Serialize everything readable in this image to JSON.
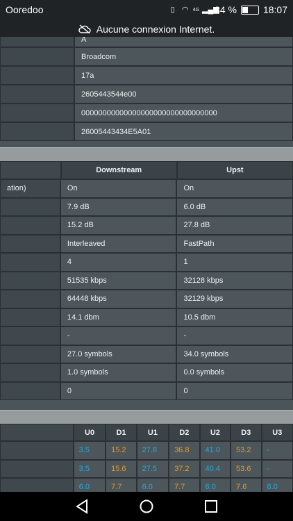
{
  "status_bar": {
    "carrier": "Ooredoo",
    "network_label": "4G",
    "battery_percent": "34 %",
    "time": "18:07"
  },
  "banner": {
    "text": "Aucune connexion Internet."
  },
  "info_table": {
    "values": [
      "A",
      "Broadcom",
      "17a",
      "2605443544e00",
      "00000000000000000000000000000000",
      "26005443434E5A01"
    ]
  },
  "line_stats": {
    "headers": [
      "Downstream",
      "Upst"
    ],
    "rows": [
      {
        "label": "ation)",
        "down": "On",
        "up": "On"
      },
      {
        "label": "",
        "down": "7.9 dB",
        "up": "6.0 dB"
      },
      {
        "label": "",
        "down": "15.2 dB",
        "up": "27.8 dB"
      },
      {
        "label": "",
        "down": "Interleaved",
        "up": "FastPath"
      },
      {
        "label": "",
        "down": "4",
        "up": "1"
      },
      {
        "label": "",
        "down": "51535 kbps",
        "up": "32128 kbps"
      },
      {
        "label": "",
        "down": "64448 kbps",
        "up": "32129 kbps"
      },
      {
        "label": "",
        "down": "14.1 dbm",
        "up": "10.5 dbm"
      },
      {
        "label": "",
        "down": "-",
        "up": "-"
      },
      {
        "label": "",
        "down": "27.0 symbols",
        "up": "34.0 symbols"
      },
      {
        "label": "",
        "down": "1.0 symbols",
        "up": "0.0 symbols"
      },
      {
        "label": "",
        "down": "0",
        "up": "0"
      }
    ]
  },
  "band_table": {
    "headers": [
      "U0",
      "D1",
      "U1",
      "D2",
      "U2",
      "D3",
      "U3"
    ],
    "rows": [
      [
        "3.5",
        "15.2",
        "27.8",
        "36.8",
        "41.0",
        "53.2",
        "-"
      ],
      [
        "3.5",
        "15.6",
        "27.5",
        "37.2",
        "40.4",
        "53.6",
        "-"
      ],
      [
        "6.0",
        "7.7",
        "6.0",
        "7.7",
        "6.0",
        "7.6",
        "6.0"
      ]
    ]
  },
  "colors": {
    "upstream": "#29a9e1",
    "downstream": "#e89a2c"
  }
}
